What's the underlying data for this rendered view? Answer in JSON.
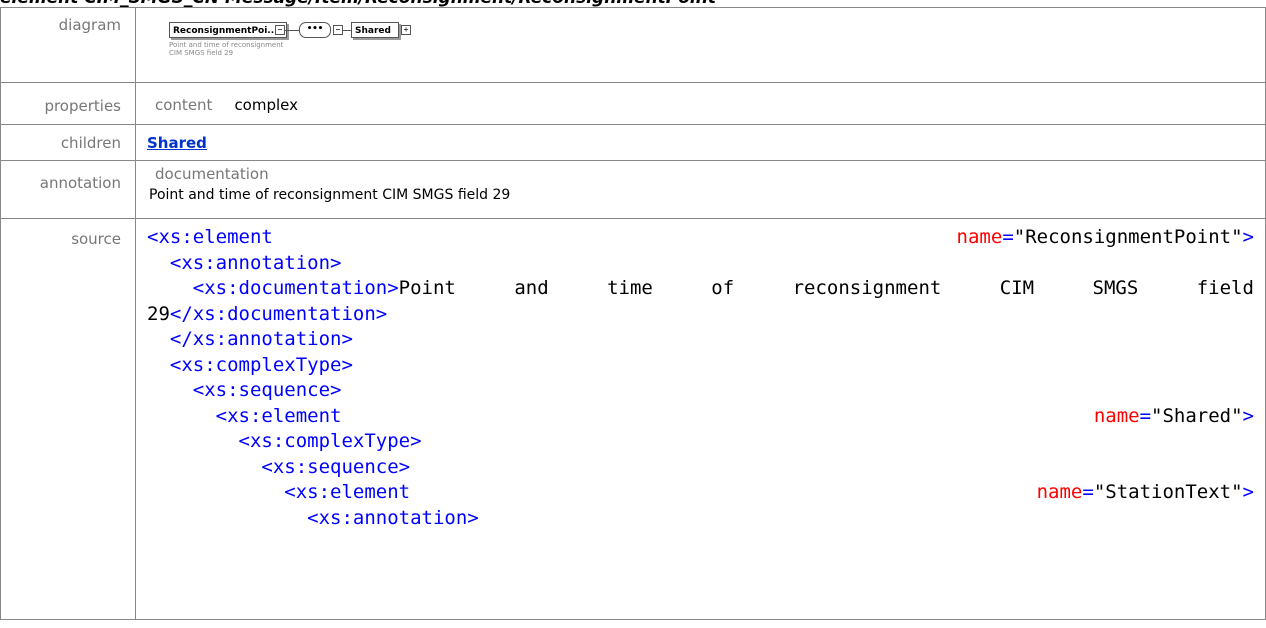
{
  "title_text": "element CIM_SMGS_CN Message/Item/Reconsignment/ReconsignmentPoint",
  "rows": {
    "diagram": "diagram",
    "properties": "properties",
    "children": "children",
    "annotation": "annotation",
    "source": "source"
  },
  "diagram": {
    "element_box": "ReconsignmentPoi...",
    "element_doc": "Point and time of reconsignment CIM SMGS field 29",
    "sequence_symbol": "•••",
    "child_box": "Shared",
    "plus": "+",
    "minus": "−"
  },
  "properties": {
    "key": "content",
    "value": "complex"
  },
  "children": {
    "link": "Shared"
  },
  "annotation": {
    "key": "documentation",
    "value": "Point and time of reconsignment CIM SMGS field 29"
  },
  "source": {
    "l1_tag": "<xs:element",
    "l1_attr": "name",
    "l1_eq": "=",
    "l1_val": "\"ReconsignmentPoint\"",
    "l1_close": ">",
    "l2": "<xs:annotation>",
    "l3_open": "<xs:documentation>",
    "l3_words": [
      "Point",
      "and",
      "time",
      "of",
      "reconsignment",
      "CIM",
      "SMGS",
      "field"
    ],
    "l4_text": "29",
    "l4_close": "</xs:documentation>",
    "l5": "</xs:annotation>",
    "l6": "<xs:complexType>",
    "l7": "<xs:sequence>",
    "l8_tag": "<xs:element",
    "l8_attr": "name",
    "l8_eq": "=",
    "l8_val": "\"Shared\"",
    "l8_close": ">",
    "l9": "<xs:complexType>",
    "l10": "<xs:sequence>",
    "l11_tag": "<xs:element",
    "l11_attr": "name",
    "l11_eq": "=",
    "l11_val": "\"StationText\"",
    "l11_close": ">",
    "l12": "<xs:annotation>"
  }
}
